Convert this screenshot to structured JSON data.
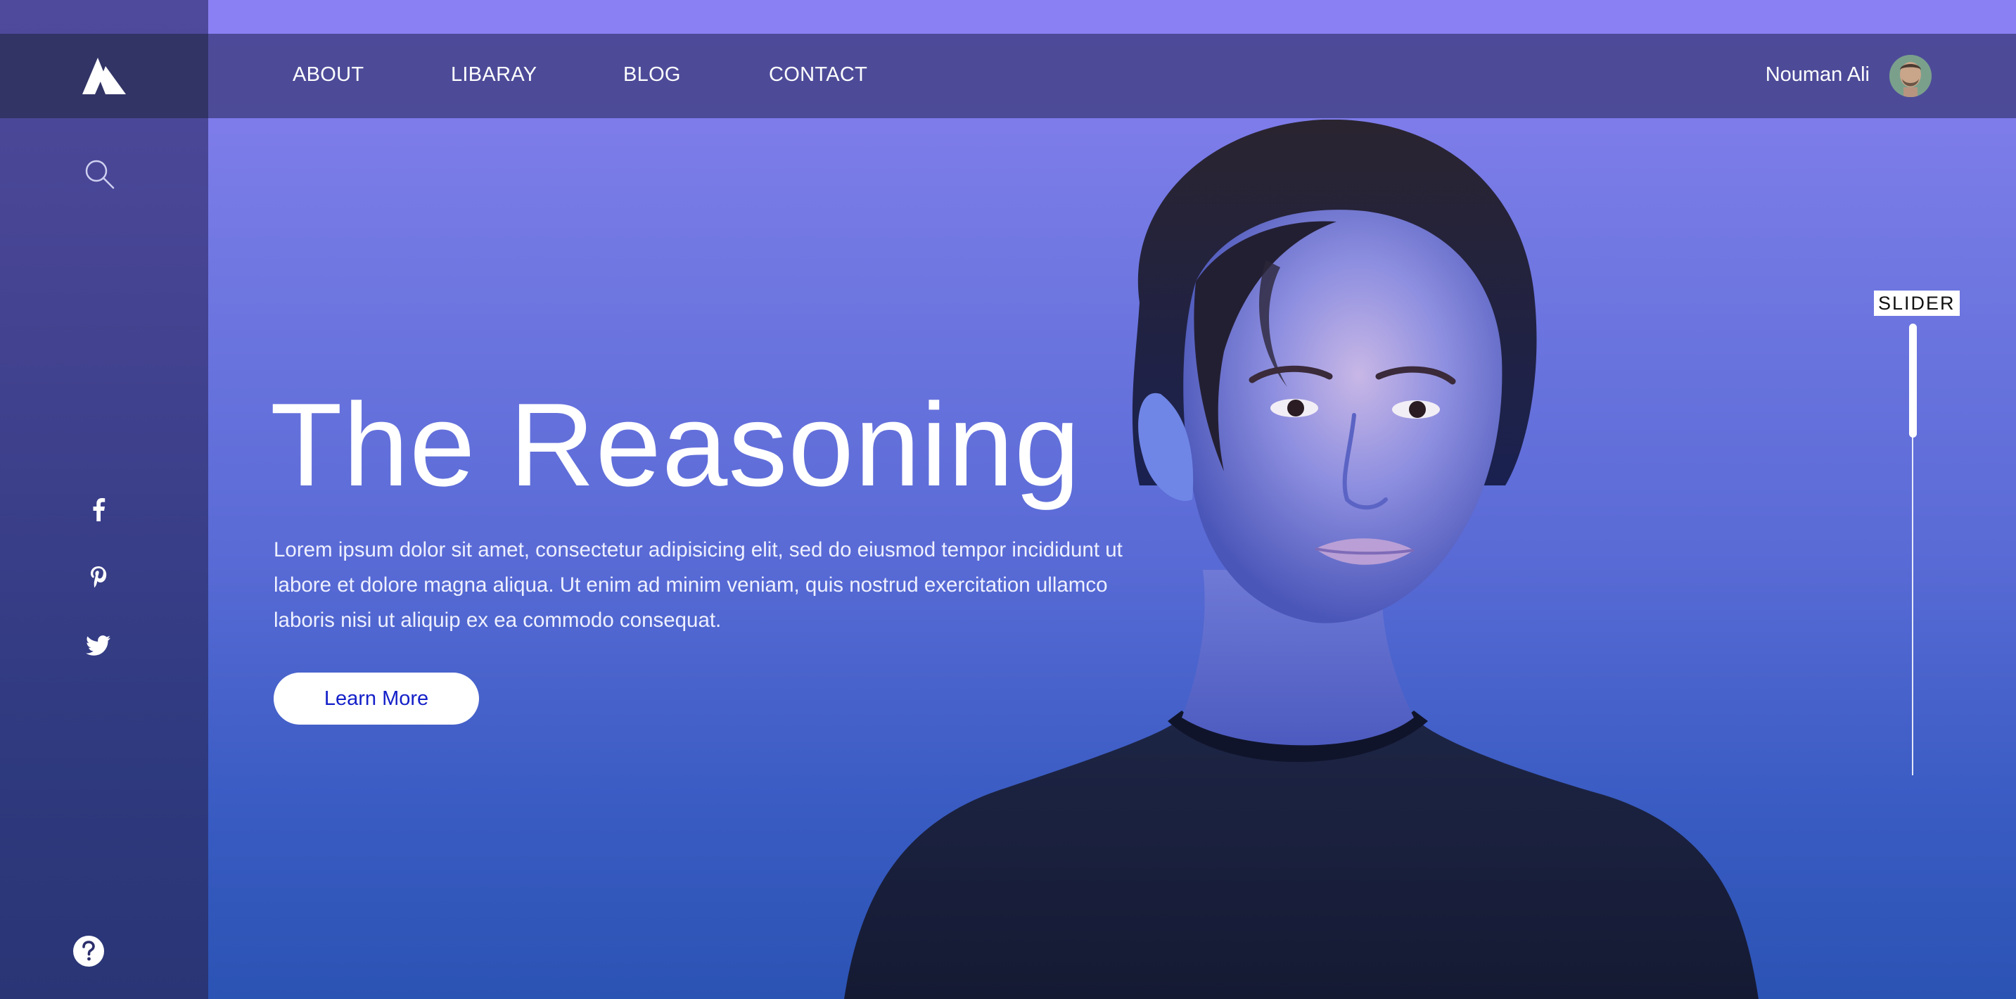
{
  "brand": {
    "logo_icon": "mountain-logo-icon"
  },
  "nav": {
    "items": [
      {
        "label": "ABOUT"
      },
      {
        "label": "LIBARAY"
      },
      {
        "label": "BLOG"
      },
      {
        "label": "CONTACT"
      }
    ]
  },
  "user": {
    "name": "Nouman Ali",
    "avatar_icon": "user-avatar"
  },
  "sidebar": {
    "search_icon": "search-icon",
    "social": [
      {
        "icon": "facebook-icon"
      },
      {
        "icon": "pinterest-icon"
      },
      {
        "icon": "twitter-icon"
      }
    ],
    "help_icon": "help-icon"
  },
  "hero": {
    "title": "The Reasoning",
    "body": "Lorem ipsum dolor sit amet, consectetur adipisicing elit, sed do eiusmod tempor incididunt ut labore et dolore magna aliqua. Ut enim ad minim veniam, quis nostrud exercitation ullamco laboris nisi ut aliquip ex ea commodo consequat.",
    "button_label": "Learn More"
  },
  "slider": {
    "label": "SLIDER",
    "position": 0.25
  },
  "colors": {
    "accent_top": "#8a80f3",
    "accent_bottom": "#2b53b4",
    "sidebar": "#40418e",
    "button_text": "#1420c8"
  }
}
